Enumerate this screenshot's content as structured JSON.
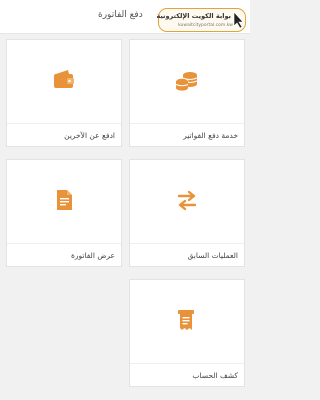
{
  "header": {
    "title": "دفع الفاتورة",
    "logo": {
      "arabic_text": "بوابة الكويت الإلكترونية",
      "english_text": "kuwaitcityportal.com.kw"
    }
  },
  "accent_color": "#e8923a",
  "cards": [
    {
      "label": "خدمة دفع الفواتير",
      "icon": "coins-stack-icon"
    },
    {
      "label": "ادفع عن الآخرين",
      "icon": "wallet-icon"
    },
    {
      "label": "العمليات السابق",
      "icon": "transfer-arrows-icon"
    },
    {
      "label": "عرض الفاتورة",
      "icon": "invoice-document-icon"
    },
    {
      "label": "كشف الحساب",
      "icon": "receipt-statement-icon"
    }
  ]
}
